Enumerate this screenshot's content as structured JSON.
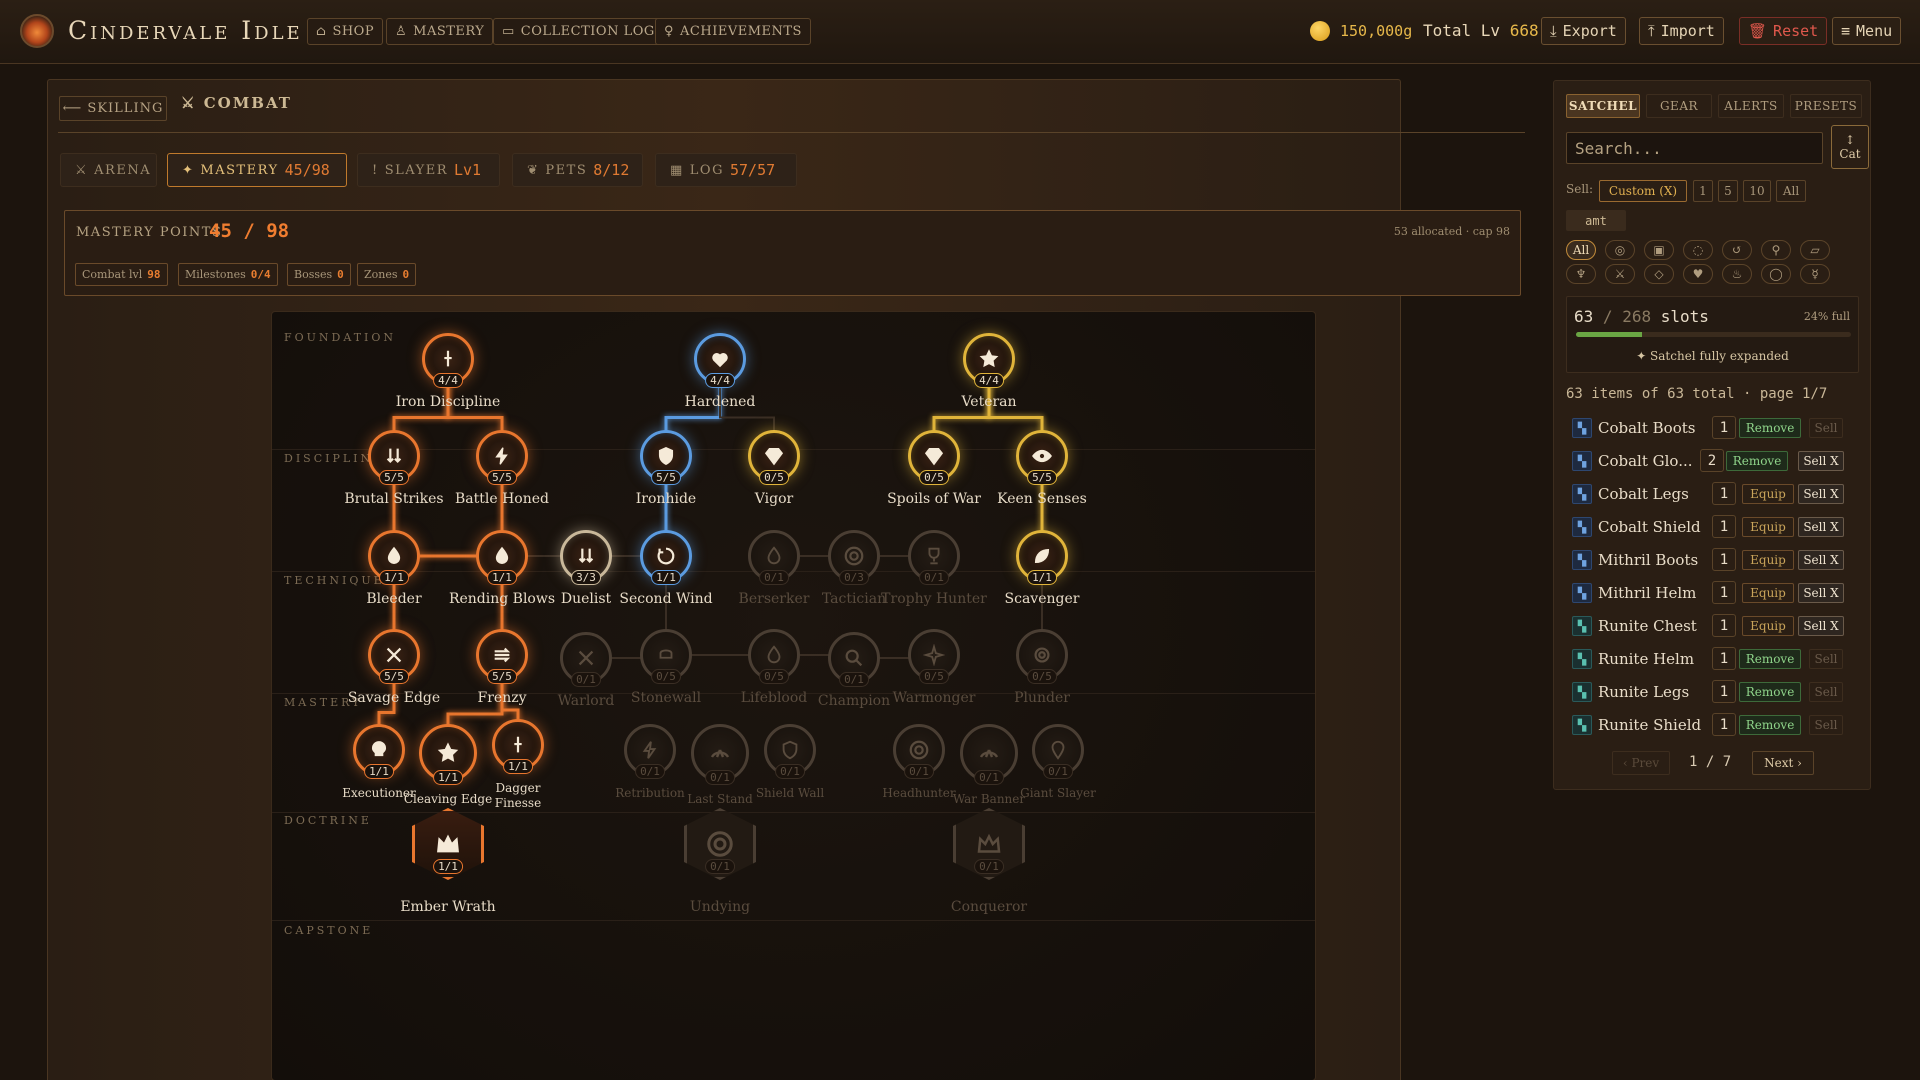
{
  "app": {
    "title": "Cindervale Idle"
  },
  "nav": [
    {
      "icon": "shop-icon",
      "label": "SHOP"
    },
    {
      "icon": "flask-icon",
      "label": "MASTERY"
    },
    {
      "icon": "book-icon",
      "label": "COLLECTION LOG"
    },
    {
      "icon": "trophy-icon",
      "label": "ACHIEVEMENTS"
    }
  ],
  "header": {
    "gold": "150,000g",
    "total_label": "Total Lv",
    "total_value": "668",
    "export": "Export",
    "import": "Import",
    "reset": "Reset",
    "menu": "Menu"
  },
  "breadcrumb": {
    "back": "⟵ SKILLING",
    "current": "COMBAT"
  },
  "tabs": [
    {
      "icon": "swords-icon",
      "label": "ARENA",
      "value": ""
    },
    {
      "icon": "sparkle-icon",
      "label": "MASTERY",
      "value": "45/98"
    },
    {
      "icon": "dagger-icon",
      "label": "SLAYER",
      "value": "Lv1"
    },
    {
      "icon": "paw-icon",
      "label": "PETS",
      "value": "8/12"
    },
    {
      "icon": "log-icon",
      "label": "LOG",
      "value": "57/57"
    }
  ],
  "mastery": {
    "label": "MASTERY POINTS",
    "value": "45 / 98",
    "note": "53 allocated · cap 98",
    "chips": [
      {
        "label": "Combat lvl",
        "value": "98"
      },
      {
        "label": "Milestones",
        "value": "0/4"
      },
      {
        "label": "Bosses",
        "value": "0"
      },
      {
        "label": "Zones",
        "value": "0"
      }
    ]
  },
  "tiers": [
    "FOUNDATION",
    "DISCIPLINE",
    "TECHNIQUE",
    "MASTERY",
    "DOCTRINE",
    "CAPSTONE"
  ],
  "nodes": [
    {
      "name": "Iron Discipline",
      "count": "4/4",
      "path": "orange",
      "active": true
    },
    {
      "name": "Hardened",
      "count": "4/4",
      "path": "blue",
      "active": true
    },
    {
      "name": "Veteran",
      "count": "4/4",
      "path": "gold",
      "active": true
    },
    {
      "name": "Brutal Strikes",
      "count": "5/5",
      "path": "orange",
      "active": true
    },
    {
      "name": "Battle Honed",
      "count": "5/5",
      "path": "orange",
      "active": true
    },
    {
      "name": "Ironhide",
      "count": "5/5",
      "path": "blue",
      "active": true
    },
    {
      "name": "Vigor",
      "count": "0/5",
      "path": "gold",
      "active": true
    },
    {
      "name": "Spoils of War",
      "count": "0/5",
      "path": "gold",
      "active": true
    },
    {
      "name": "Keen Senses",
      "count": "5/5",
      "path": "gold",
      "active": true
    },
    {
      "name": "Bleeder",
      "count": "1/1",
      "path": "orange",
      "active": true
    },
    {
      "name": "Rending Blows",
      "count": "1/1",
      "path": "orange",
      "active": true
    },
    {
      "name": "Duelist",
      "count": "3/3",
      "path": "neutral",
      "active": true
    },
    {
      "name": "Second Wind",
      "count": "1/1",
      "path": "blue",
      "active": true
    },
    {
      "name": "Berserker",
      "count": "0/1",
      "path": "grey",
      "active": false
    },
    {
      "name": "Tactician",
      "count": "0/3",
      "path": "grey",
      "active": false
    },
    {
      "name": "Trophy Hunter",
      "count": "0/1",
      "path": "grey",
      "active": false
    },
    {
      "name": "Scavenger",
      "count": "1/1",
      "path": "gold",
      "active": true
    },
    {
      "name": "Savage Edge",
      "count": "5/5",
      "path": "orange",
      "active": true
    },
    {
      "name": "Frenzy",
      "count": "5/5",
      "path": "orange",
      "active": true
    },
    {
      "name": "Warlord",
      "count": "0/1",
      "path": "grey",
      "active": false
    },
    {
      "name": "Stonewall",
      "count": "0/5",
      "path": "grey",
      "active": false
    },
    {
      "name": "Lifeblood",
      "count": "0/5",
      "path": "grey",
      "active": false
    },
    {
      "name": "Champion",
      "count": "0/1",
      "path": "grey",
      "active": false
    },
    {
      "name": "Warmonger",
      "count": "0/5",
      "path": "grey",
      "active": false
    },
    {
      "name": "Plunder",
      "count": "0/5",
      "path": "grey",
      "active": false
    },
    {
      "name": "Executioner",
      "count": "1/1",
      "path": "orange",
      "active": true
    },
    {
      "name": "Cleaving Edge",
      "count": "1/1",
      "path": "orange",
      "active": true
    },
    {
      "name": "Dagger Finesse",
      "count": "1/1",
      "path": "orange",
      "active": true
    },
    {
      "name": "Retribution",
      "count": "0/1",
      "path": "grey",
      "active": false
    },
    {
      "name": "Last Stand",
      "count": "0/1",
      "path": "grey",
      "active": false
    },
    {
      "name": "Shield Wall",
      "count": "0/1",
      "path": "grey",
      "active": false
    },
    {
      "name": "Headhunter",
      "count": "0/1",
      "path": "grey",
      "active": false
    },
    {
      "name": "War Banner",
      "count": "0/1",
      "path": "grey",
      "active": false
    },
    {
      "name": "Giant Slayer",
      "count": "0/1",
      "path": "grey",
      "active": false
    },
    {
      "name": "Ember Wrath",
      "count": "1/1",
      "path": "orange",
      "active": true
    },
    {
      "name": "Undying",
      "count": "0/1",
      "path": "grey",
      "active": false
    },
    {
      "name": "Conqueror",
      "count": "0/1",
      "path": "grey",
      "active": false
    }
  ],
  "colors": {
    "orange": "#e8762e",
    "blue": "#5b9be0",
    "gold": "#e0b43a",
    "neutral": "#c9b89a",
    "grey": "#4a3e33"
  },
  "satchel": {
    "tabs": [
      "SATCHEL",
      "GEAR",
      "ALERTS",
      "PRESETS"
    ],
    "search_placeholder": "Search...",
    "cat_label": "Cat",
    "sell_label": "Sell:",
    "sell_options": [
      "Custom (X)",
      "1",
      "5",
      "10",
      "All"
    ],
    "amt_label": "amt",
    "filter_all": "All",
    "slots_used": "63",
    "slots_total": "268",
    "slots_word": "slots",
    "slots_pct": "24% full",
    "fill": 0.24,
    "expanded": "✦ Satchel fully expanded",
    "items_info": "63 items of 63 total · page 1/7",
    "items": [
      {
        "name": "Cobalt Boots",
        "qty": "1",
        "action": "Remove",
        "sell": "Sell"
      },
      {
        "name": "Cobalt Glo...",
        "qty": "2",
        "action": "Remove",
        "sell": "Sell X"
      },
      {
        "name": "Cobalt Legs",
        "qty": "1",
        "action": "Equip",
        "sell": "Sell X"
      },
      {
        "name": "Cobalt Shield",
        "qty": "1",
        "action": "Equip",
        "sell": "Sell X"
      },
      {
        "name": "Mithril Boots",
        "qty": "1",
        "action": "Equip",
        "sell": "Sell X"
      },
      {
        "name": "Mithril Helm",
        "qty": "1",
        "action": "Equip",
        "sell": "Sell X"
      },
      {
        "name": "Runite Chest",
        "qty": "1",
        "action": "Equip",
        "sell": "Sell X"
      },
      {
        "name": "Runite Helm",
        "qty": "1",
        "action": "Remove",
        "sell": "Sell"
      },
      {
        "name": "Runite Legs",
        "qty": "1",
        "action": "Remove",
        "sell": "Sell"
      },
      {
        "name": "Runite Shield",
        "qty": "1",
        "action": "Remove",
        "sell": "Sell"
      }
    ],
    "prev": "‹ Prev",
    "page": "1 / 7",
    "next": "Next ›"
  }
}
